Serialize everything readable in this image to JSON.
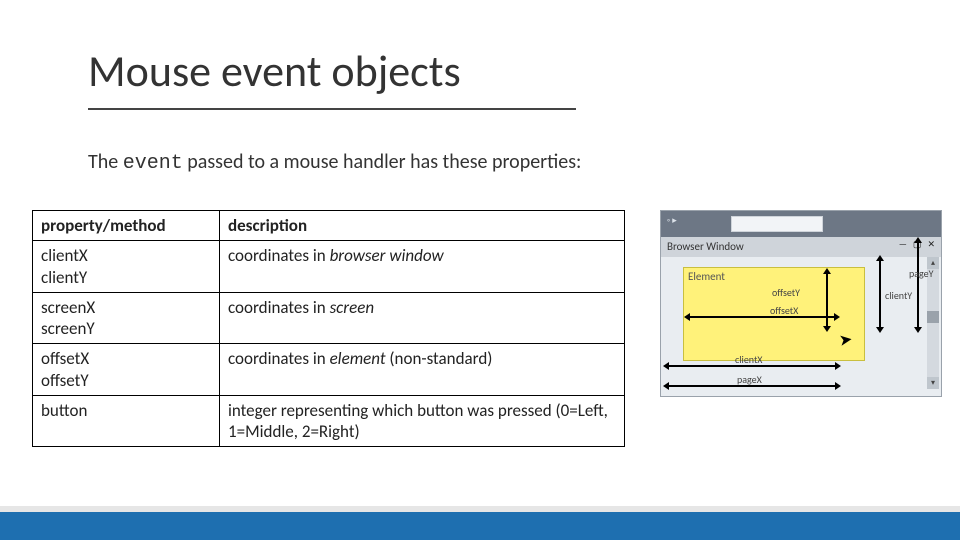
{
  "title": "Mouse event objects",
  "intro_before": "The ",
  "intro_code": "event",
  "intro_after": " passed to a mouse handler has these properties:",
  "table": {
    "header": {
      "left": "property/method",
      "right": "description"
    },
    "rows": [
      {
        "left_lines": [
          "clientX",
          "clientY"
        ],
        "right_html": "coordinates in <em>browser window</em>"
      },
      {
        "left_lines": [
          "screenX",
          "screenY"
        ],
        "right_html": "coordinates in <em>screen</em>"
      },
      {
        "left_lines": [
          "offsetX",
          "offsetY"
        ],
        "right_html": "coordinates in <em>element</em> (non-standard)"
      },
      {
        "left_lines": [
          "button"
        ],
        "right_html": "integer representing which button was pressed (0=Left, 1=Middle, 2=Right)"
      }
    ]
  },
  "diagram": {
    "screen_tab": "",
    "browser_window": "Browser Window",
    "element": "Element",
    "labels": {
      "offsetX": "offsetX",
      "offsetY": "offsetY",
      "clientX": "clientX",
      "clientY": "clientY",
      "pageX": "pageX",
      "pageY": "pageY"
    }
  }
}
